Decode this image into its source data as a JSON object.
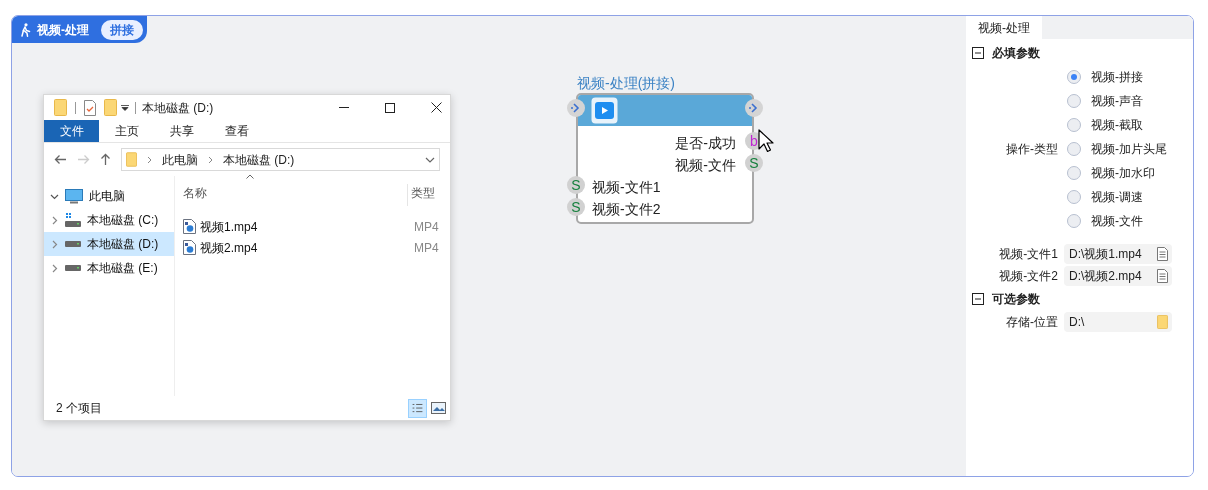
{
  "header": {
    "title": "视频-处理",
    "badge": "拼接"
  },
  "explorer": {
    "title": "本地磁盘 (D:)",
    "ribbon_tabs": [
      {
        "label": "文件",
        "selected": true
      },
      {
        "label": "主页",
        "selected": false
      },
      {
        "label": "共享",
        "selected": false
      },
      {
        "label": "查看",
        "selected": false
      }
    ],
    "address": [
      "此电脑",
      "本地磁盘 (D:)"
    ],
    "tree": [
      {
        "label": "此电脑",
        "kind": "pc",
        "expanded": true,
        "selected": false,
        "children": [
          {
            "label": "本地磁盘 (C:)",
            "kind": "system-drive",
            "expanded": false,
            "selected": false
          },
          {
            "label": "本地磁盘 (D:)",
            "kind": "drive",
            "expanded": false,
            "selected": true
          },
          {
            "label": "本地磁盘 (E:)",
            "kind": "drive",
            "expanded": false,
            "selected": false
          }
        ]
      }
    ],
    "columns": [
      "名称",
      "类型"
    ],
    "files": [
      {
        "name": "视频1.mp4",
        "type": "MP4"
      },
      {
        "name": "视频2.mp4",
        "type": "MP4"
      }
    ],
    "status": "2 个项目"
  },
  "node": {
    "title": "视频-处理(拼接)",
    "outputs": [
      {
        "label": "是否-成功",
        "port": "b",
        "color": "#c026d3"
      },
      {
        "label": "视频-文件",
        "port": "S",
        "color": "#15803d"
      }
    ],
    "inputs": [
      {
        "label": "视频-文件1",
        "port": "S",
        "color": "#15803d"
      },
      {
        "label": "视频-文件2",
        "port": "S",
        "color": "#15803d"
      }
    ]
  },
  "panel": {
    "tab": "视频-处理",
    "sections": [
      {
        "title": "必填参数",
        "expanded": true,
        "fields": [
          {
            "kind": "radio",
            "label": "操作-类型",
            "options": [
              {
                "label": "视频-拼接",
                "selected": true
              },
              {
                "label": "视频-声音",
                "selected": false
              },
              {
                "label": "视频-截取",
                "selected": false
              },
              {
                "label": "视频-加片头尾",
                "selected": false
              },
              {
                "label": "视频-加水印",
                "selected": false
              },
              {
                "label": "视频-调速",
                "selected": false
              },
              {
                "label": "视频-文件",
                "selected": false
              }
            ]
          },
          {
            "kind": "file",
            "label": "视频-文件1",
            "value": "D:\\视频1.mp4"
          },
          {
            "kind": "file",
            "label": "视频-文件2",
            "value": "D:\\视频2.mp4"
          }
        ]
      },
      {
        "title": "可选参数",
        "expanded": true,
        "fields": [
          {
            "kind": "folder",
            "label": "存储-位置",
            "value": "D:\\"
          }
        ]
      }
    ]
  }
}
